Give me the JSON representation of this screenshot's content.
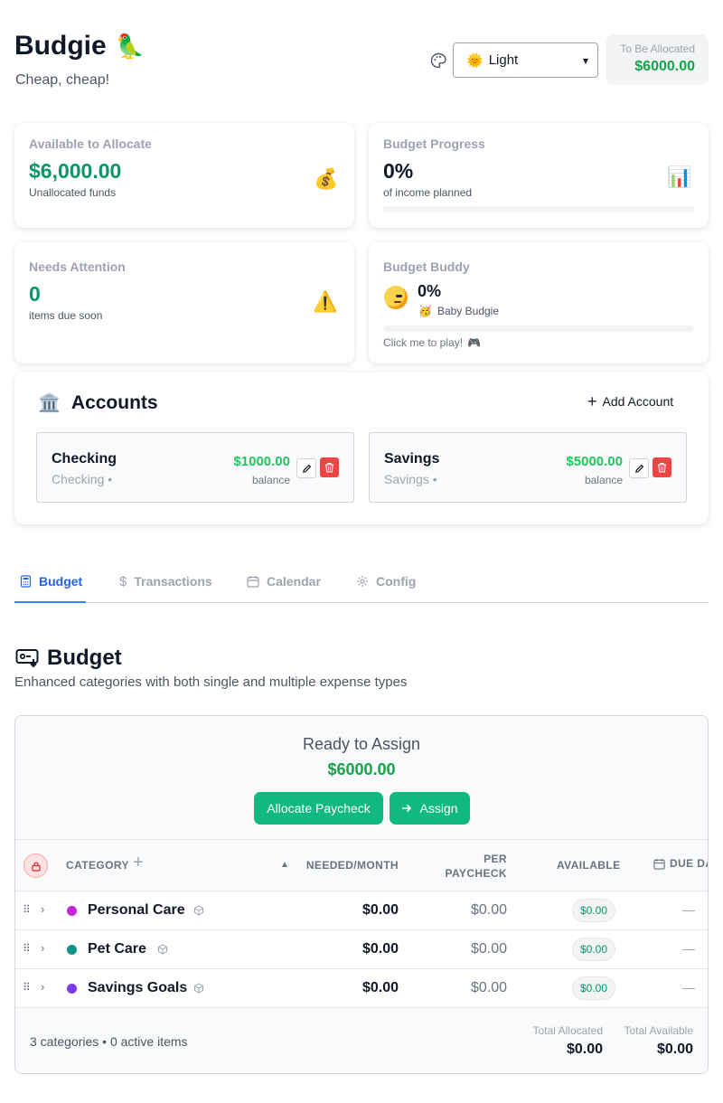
{
  "header": {
    "app_name": "Budgie",
    "tagline": "Cheap, cheap!",
    "theme_value": "Light",
    "to_be_allocated_label": "To Be Allocated",
    "to_be_allocated_value": "$6000.00"
  },
  "stats": {
    "available": {
      "label": "Available to Allocate",
      "value": "$6,000.00",
      "sub": "Unallocated funds",
      "icon": "money-bag-icon"
    },
    "progress": {
      "label": "Budget Progress",
      "value": "0%",
      "sub": "of income planned",
      "fraction": 0,
      "icon": "bar-chart-icon"
    },
    "attention": {
      "label": "Needs Attention",
      "value": "0",
      "sub": "items due soon",
      "icon": "warning-icon"
    },
    "buddy": {
      "label": "Budget Buddy",
      "value": "0%",
      "level": "Baby Budgie",
      "cta": "Click me to play!",
      "fraction": 0
    }
  },
  "accounts": {
    "title": "Accounts",
    "add_label": "Add Account",
    "items": [
      {
        "name": "Checking",
        "type": "Checking •",
        "balance": "$1000.00",
        "balance_label": "balance"
      },
      {
        "name": "Savings",
        "type": "Savings •",
        "balance": "$5000.00",
        "balance_label": "balance"
      }
    ]
  },
  "tabs": [
    {
      "label": "Budget",
      "active": true
    },
    {
      "label": "Transactions",
      "active": false
    },
    {
      "label": "Calendar",
      "active": false
    },
    {
      "label": "Config",
      "active": false
    }
  ],
  "budget": {
    "title": "Budget",
    "subtitle": "Enhanced categories with both single and multiple expense types",
    "ready_label": "Ready to Assign",
    "ready_value": "$6000.00",
    "allocate_label": "Allocate Paycheck",
    "assign_label": "Assign",
    "columns": {
      "category": "CATEGORY",
      "needed": "NEEDED/MONTH",
      "per_paycheck_1": "PER",
      "per_paycheck_2": "PAYCHECK",
      "available": "AVAILABLE",
      "due": "DUE DA"
    },
    "rows": [
      {
        "name": "Personal Care",
        "color": "#c026d3",
        "needed": "$0.00",
        "per_paycheck": "$0.00",
        "available": "$0.00",
        "due": "—"
      },
      {
        "name": "Pet Care",
        "color": "#0d9488",
        "needed": "$0.00",
        "per_paycheck": "$0.00",
        "available": "$0.00",
        "due": "—"
      },
      {
        "name": "Savings Goals",
        "color": "#7c3aed",
        "needed": "$0.00",
        "per_paycheck": "$0.00",
        "available": "$0.00",
        "due": "—"
      }
    ],
    "footer": {
      "summary": "3 categories • 0 active items",
      "total_allocated_label": "Total Allocated",
      "total_allocated": "$0.00",
      "total_available_label": "Total Available",
      "total_available": "$0.00"
    }
  }
}
